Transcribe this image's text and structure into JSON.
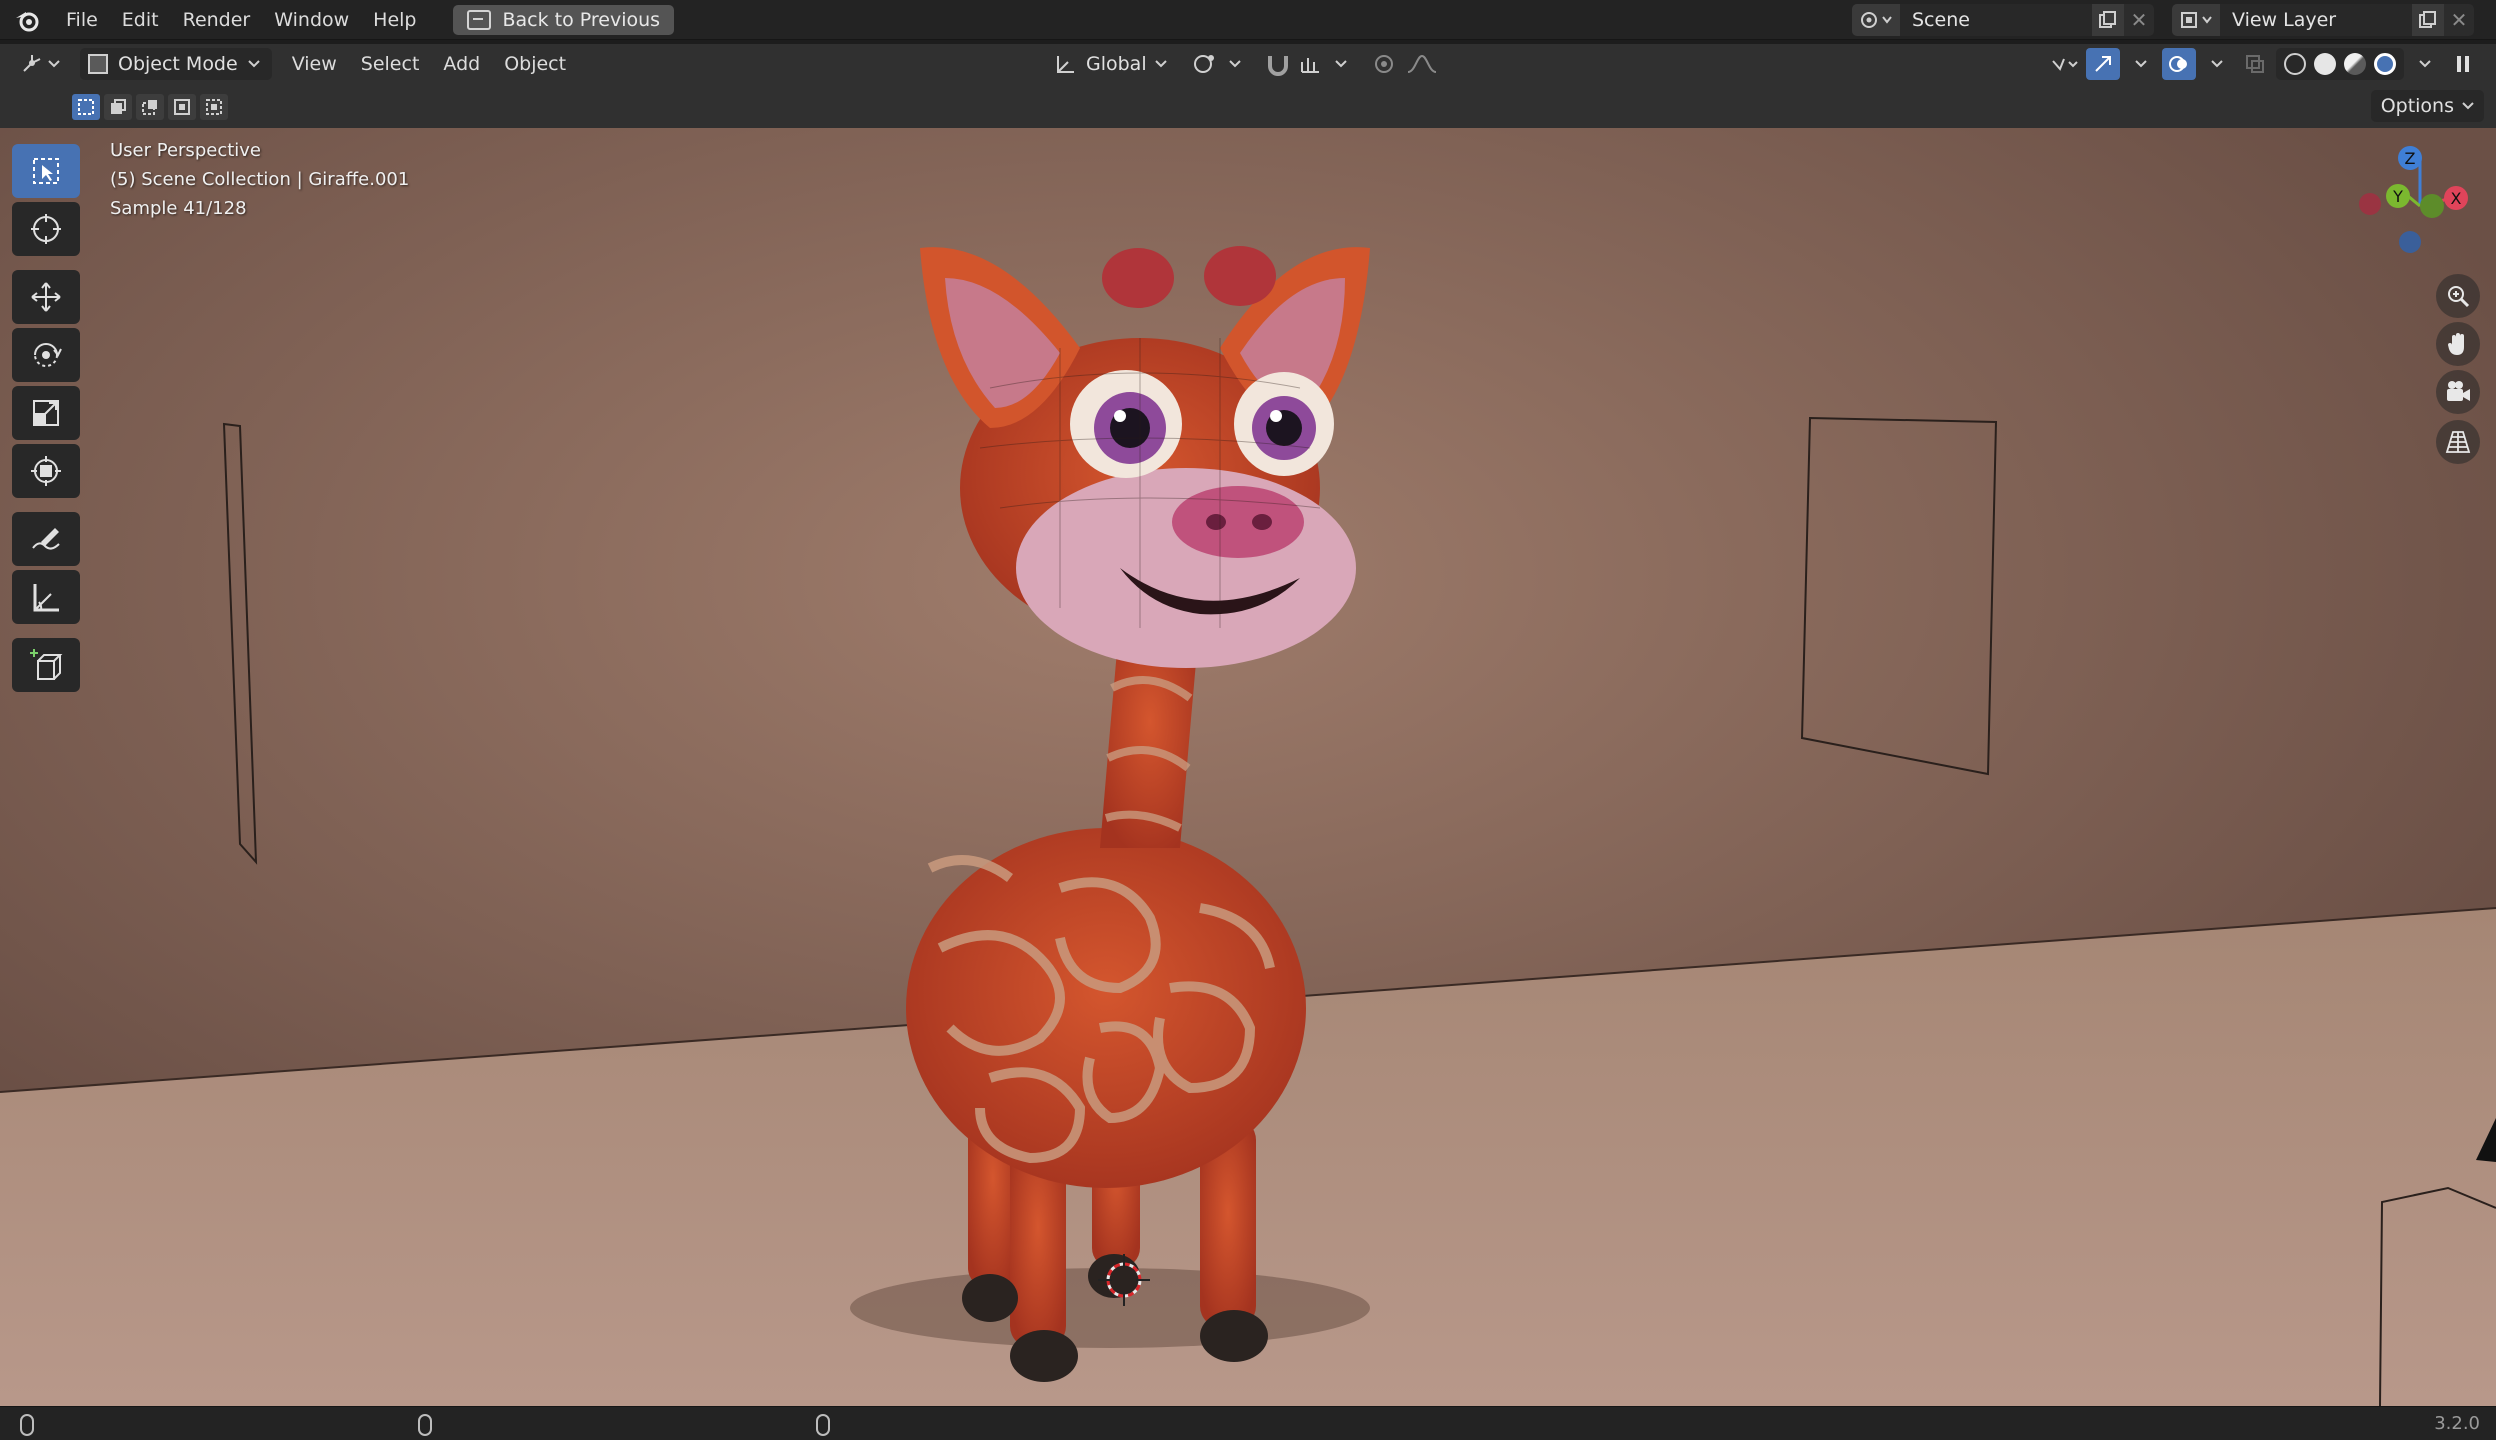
{
  "menubar": {
    "items": [
      "File",
      "Edit",
      "Render",
      "Window",
      "Help"
    ],
    "back_button": "Back to Previous",
    "scene_name": "Scene",
    "view_layer_name": "View Layer"
  },
  "header": {
    "mode": "Object Mode",
    "menus": [
      "View",
      "Select",
      "Add",
      "Object"
    ],
    "transform_orientation": "Global"
  },
  "subheader": {
    "options_label": "Options"
  },
  "viewport": {
    "view_name": "User Perspective",
    "collection_info": "(5) Scene Collection | Giraffe.001",
    "sample_info": "Sample 41/128",
    "gizmo_labels": {
      "z": "Z",
      "y": "Y",
      "x": "X"
    }
  },
  "toolshelf": [
    "select-box",
    "cursor",
    "move",
    "rotate",
    "scale",
    "transform",
    "annotate",
    "measure",
    "add-cube"
  ],
  "statusbar": {
    "version": "3.2.0"
  },
  "colors": {
    "accent": "#4772b3",
    "axis_x": "#e0445a",
    "axis_y": "#7bb82f",
    "axis_z": "#3f7fd6"
  }
}
